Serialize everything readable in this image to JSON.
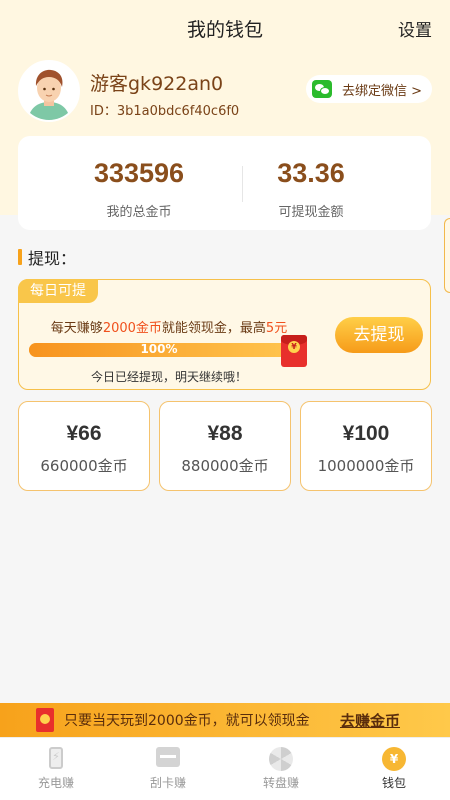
{
  "header": {
    "title": "我的钱包",
    "settings_label": "设置"
  },
  "user": {
    "name": "游客gk922an0",
    "id_text": "ID：3b1a0bdc6f40c6f0",
    "bind_wechat_label": "去绑定微信 >"
  },
  "stats": [
    {
      "value": "333596",
      "label": "我的总金币"
    },
    {
      "value": "33.36",
      "label": "可提现金额"
    }
  ],
  "withdraw_section": {
    "title": "提现："
  },
  "daily": {
    "tag": "每日可提",
    "desc_prefix": "每天赚够",
    "desc_highlight1": "2000金币",
    "desc_mid": "就能领现金，最高",
    "desc_highlight2": "5元",
    "progress_text": "100%",
    "progress_value": 1.0,
    "note": "今日已经提现，明天继续哦！",
    "button_label": "去提现"
  },
  "options": [
    {
      "amount": "¥66",
      "coins": "660000金币"
    },
    {
      "amount": "¥88",
      "coins": "880000金币"
    },
    {
      "amount": "¥100",
      "coins": "1000000金币"
    }
  ],
  "promo": {
    "text": "只要当天玩到2000金币，就可以领现金",
    "link_label": "去赚金币"
  },
  "nav": [
    {
      "label": "充电赚",
      "icon": "charge-icon"
    },
    {
      "label": "刮卡赚",
      "icon": "scratch-card-icon"
    },
    {
      "label": "转盘赚",
      "icon": "wheel-icon"
    },
    {
      "label": "钱包",
      "icon": "wallet-icon"
    }
  ],
  "colors": {
    "accent": "#f7a21b",
    "brown": "#8a4e1c",
    "highlight": "#f0511d",
    "header_bg": "#fff7e1"
  }
}
